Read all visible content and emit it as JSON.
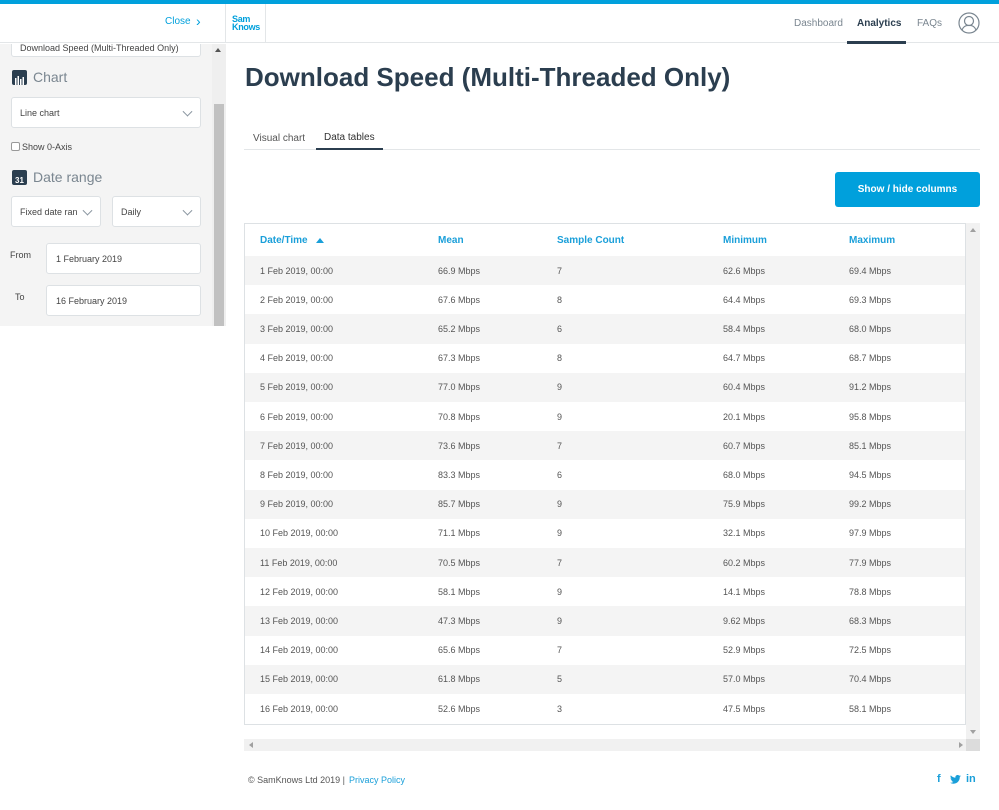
{
  "header": {
    "close_label": "Close",
    "close_chevron": "›",
    "logo_line1": "Sam",
    "logo_line2": "Knows",
    "nav": [
      {
        "label": "Dashboard",
        "active": false
      },
      {
        "label": "Analytics",
        "active": true
      },
      {
        "label": "FAQs",
        "active": false
      }
    ],
    "user_icon": "user-circle-icon"
  },
  "sidebar": {
    "metric_select_value": "Download Speed (Multi-Threaded Only)",
    "chart_section": {
      "title": "Chart",
      "icon": "bar-chart-icon"
    },
    "chart_type_select": "Line chart",
    "show_zero_axis": {
      "label": "Show 0-Axis",
      "checked": false
    },
    "date_section": {
      "title": "Date range",
      "icon": "calendar-icon",
      "icon_text": "31"
    },
    "date_mode_select": "Fixed date ran",
    "granularity_select": "Daily",
    "from_label": "From",
    "from_value": "1 February 2019",
    "to_label": "To",
    "to_value": "16 February 2019"
  },
  "main": {
    "title": "Download Speed (Multi-Threaded Only)",
    "tabs": [
      {
        "label": "Visual chart",
        "active": false
      },
      {
        "label": "Data tables",
        "active": true
      }
    ],
    "columns_button": "Show / hide columns",
    "table": {
      "headers": [
        "Date/Time",
        "Mean",
        "Sample Count",
        "Minimum",
        "Maximum"
      ],
      "sort": {
        "column": "Date/Time",
        "direction": "ascending"
      },
      "rows": [
        [
          "1 Feb 2019, 00:00",
          "66.9 Mbps",
          "7",
          "62.6 Mbps",
          "69.4 Mbps"
        ],
        [
          "2 Feb 2019, 00:00",
          "67.6 Mbps",
          "8",
          "64.4 Mbps",
          "69.3 Mbps"
        ],
        [
          "3 Feb 2019, 00:00",
          "65.2 Mbps",
          "6",
          "58.4 Mbps",
          "68.0 Mbps"
        ],
        [
          "4 Feb 2019, 00:00",
          "67.3 Mbps",
          "8",
          "64.7 Mbps",
          "68.7 Mbps"
        ],
        [
          "5 Feb 2019, 00:00",
          "77.0 Mbps",
          "9",
          "60.4 Mbps",
          "91.2 Mbps"
        ],
        [
          "6 Feb 2019, 00:00",
          "70.8 Mbps",
          "9",
          "20.1 Mbps",
          "95.8 Mbps"
        ],
        [
          "7 Feb 2019, 00:00",
          "73.6 Mbps",
          "7",
          "60.7 Mbps",
          "85.1 Mbps"
        ],
        [
          "8 Feb 2019, 00:00",
          "83.3 Mbps",
          "6",
          "68.0 Mbps",
          "94.5 Mbps"
        ],
        [
          "9 Feb 2019, 00:00",
          "85.7 Mbps",
          "9",
          "75.9 Mbps",
          "99.2 Mbps"
        ],
        [
          "10 Feb 2019, 00:00",
          "71.1 Mbps",
          "9",
          "32.1 Mbps",
          "97.9 Mbps"
        ],
        [
          "11 Feb 2019, 00:00",
          "70.5 Mbps",
          "7",
          "60.2 Mbps",
          "77.9 Mbps"
        ],
        [
          "12 Feb 2019, 00:00",
          "58.1 Mbps",
          "9",
          "14.1 Mbps",
          "78.8 Mbps"
        ],
        [
          "13 Feb 2019, 00:00",
          "47.3 Mbps",
          "9",
          "9.62 Mbps",
          "68.3 Mbps"
        ],
        [
          "14 Feb 2019, 00:00",
          "65.6 Mbps",
          "7",
          "52.9 Mbps",
          "72.5 Mbps"
        ],
        [
          "15 Feb 2019, 00:00",
          "61.8 Mbps",
          "5",
          "57.0 Mbps",
          "70.4 Mbps"
        ],
        [
          "16 Feb 2019, 00:00",
          "52.6 Mbps",
          "3",
          "47.5 Mbps",
          "58.1 Mbps"
        ]
      ]
    }
  },
  "footer": {
    "copyright": "© SamKnows Ltd 2019 |",
    "privacy_link": "Privacy Policy",
    "social": [
      {
        "name": "facebook-icon",
        "glyph": "f"
      },
      {
        "name": "twitter-icon",
        "glyph": "🐦"
      },
      {
        "name": "linkedin-icon",
        "glyph": "in"
      }
    ]
  },
  "colors": {
    "accent": "#00a0dc",
    "heading": "#2b3e4f",
    "table_header": "#1a9fd9",
    "row_stripe": "#f4f4f4"
  }
}
